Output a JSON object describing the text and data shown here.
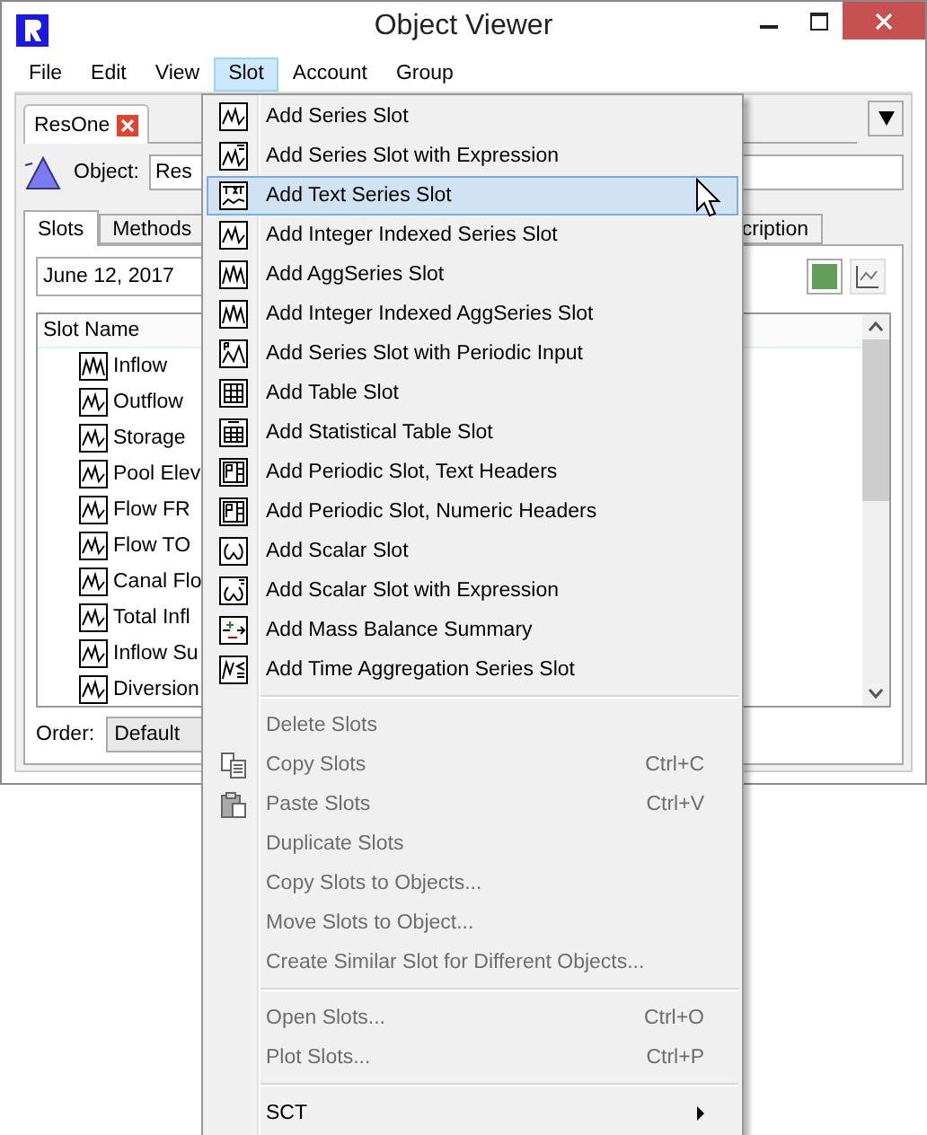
{
  "window": {
    "title": "Object Viewer"
  },
  "menu_bar": [
    {
      "label": "File",
      "selected": false
    },
    {
      "label": "Edit",
      "selected": false
    },
    {
      "label": "View",
      "selected": false
    },
    {
      "label": "Slot",
      "selected": true
    },
    {
      "label": "Account",
      "selected": false
    },
    {
      "label": "Group",
      "selected": false
    }
  ],
  "object_tabs": [
    {
      "label": "ResOne"
    }
  ],
  "object": {
    "label": "Object:",
    "value": "Res"
  },
  "tabs": [
    {
      "label": "Slots",
      "selected": true
    },
    {
      "label": "Methods",
      "selected": false
    },
    {
      "label": "cription",
      "selected": false
    }
  ],
  "date": {
    "value": "June 12, 2017"
  },
  "slot_list": {
    "header": "Slot Name",
    "rows": [
      {
        "name": "Inflow",
        "kind": "agg"
      },
      {
        "name": "Outflow",
        "kind": "series"
      },
      {
        "name": "Storage",
        "kind": "series"
      },
      {
        "name": "Pool Elev",
        "kind": "series"
      },
      {
        "name": "Flow FR",
        "kind": "series"
      },
      {
        "name": "Flow TO",
        "kind": "series"
      },
      {
        "name": "Canal Flo",
        "kind": "series"
      },
      {
        "name": "Total Infl",
        "kind": "series"
      },
      {
        "name": "Inflow Su",
        "kind": "series"
      },
      {
        "name": "Diversion",
        "kind": "series"
      }
    ]
  },
  "order": {
    "label": "Order:",
    "value": "Default"
  },
  "slot_menu": {
    "items": [
      {
        "kind": "series",
        "label": "Add Series Slot",
        "disabled": false,
        "selected": false
      },
      {
        "kind": "series_expr",
        "label": "Add Series Slot with Expression",
        "disabled": false,
        "selected": false
      },
      {
        "kind": "text_series",
        "label": "Add Text Series Slot",
        "disabled": false,
        "selected": true
      },
      {
        "kind": "series",
        "label": "Add Integer Indexed Series Slot",
        "disabled": false,
        "selected": false
      },
      {
        "kind": "agg",
        "label": "Add AggSeries Slot",
        "disabled": false,
        "selected": false
      },
      {
        "kind": "agg",
        "label": "Add Integer Indexed AggSeries Slot",
        "disabled": false,
        "selected": false
      },
      {
        "kind": "periodic_input",
        "label": "Add Series Slot with Periodic Input",
        "disabled": false,
        "selected": false
      },
      {
        "kind": "table",
        "label": "Add Table Slot",
        "disabled": false,
        "selected": false
      },
      {
        "kind": "stat_table",
        "label": "Add Statistical Table Slot",
        "disabled": false,
        "selected": false
      },
      {
        "kind": "periodic",
        "label": "Add Periodic Slot, Text Headers",
        "disabled": false,
        "selected": false
      },
      {
        "kind": "periodic",
        "label": "Add Periodic Slot, Numeric Headers",
        "disabled": false,
        "selected": false
      },
      {
        "kind": "scalar",
        "label": "Add Scalar Slot",
        "disabled": false,
        "selected": false
      },
      {
        "kind": "scalar_expr",
        "label": "Add Scalar Slot with Expression",
        "disabled": false,
        "selected": false
      },
      {
        "kind": "mass_balance",
        "label": "Add Mass Balance Summary",
        "disabled": false,
        "selected": false
      },
      {
        "kind": "time_agg",
        "label": "Add Time Aggregation Series Slot",
        "disabled": false,
        "selected": false
      },
      {
        "kind": "separator"
      },
      {
        "kind": "plain",
        "label": "Delete Slots",
        "disabled": true,
        "selected": false
      },
      {
        "kind": "copy",
        "label": "Copy Slots",
        "shortcut": "Ctrl+C",
        "disabled": true,
        "selected": false
      },
      {
        "kind": "paste",
        "label": "Paste Slots",
        "shortcut": "Ctrl+V",
        "disabled": true,
        "selected": false
      },
      {
        "kind": "plain",
        "label": "Duplicate Slots",
        "disabled": true,
        "selected": false
      },
      {
        "kind": "plain",
        "label": "Copy Slots to Objects...",
        "disabled": true,
        "selected": false
      },
      {
        "kind": "plain",
        "label": "Move Slots to Object...",
        "disabled": true,
        "selected": false
      },
      {
        "kind": "plain",
        "label": "Create Similar Slot for Different Objects...",
        "disabled": true,
        "selected": false
      },
      {
        "kind": "separator"
      },
      {
        "kind": "plain",
        "label": "Open Slots...",
        "shortcut": "Ctrl+O",
        "disabled": true,
        "selected": false
      },
      {
        "kind": "plain",
        "label": "Plot Slots...",
        "shortcut": "Ctrl+P",
        "disabled": true,
        "selected": false
      },
      {
        "kind": "separator"
      },
      {
        "kind": "plain",
        "label": "SCT",
        "submenu": true,
        "disabled": false,
        "selected": false
      }
    ]
  }
}
